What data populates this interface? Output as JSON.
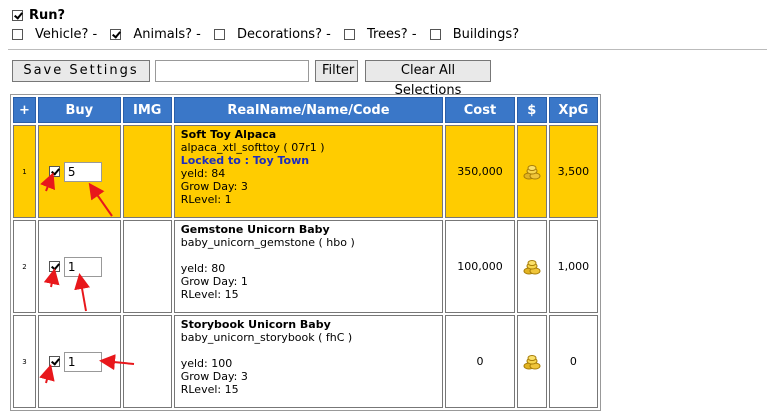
{
  "run": {
    "label": "Run?",
    "checked": true
  },
  "filters": [
    {
      "label": "Vehicle? -",
      "checked": false
    },
    {
      "label": "Animals? -",
      "checked": true
    },
    {
      "label": "Decorations? -",
      "checked": false
    },
    {
      "label": "Trees? -",
      "checked": false
    },
    {
      "label": "Buildings?",
      "checked": false
    }
  ],
  "toolbar": {
    "save_label": "Save Settings",
    "filter_value": "",
    "filter_label": "Filter",
    "clear_label": "Clear All Selections"
  },
  "table": {
    "headers": {
      "plus": "+",
      "buy": "Buy",
      "img": "IMG",
      "name": "RealName/Name/Code",
      "cost": "Cost",
      "currency": "$",
      "xpg": "XpG"
    },
    "rows": [
      {
        "index": "1",
        "checked": true,
        "qty": "5",
        "real_name": "Soft Toy Alpaca",
        "code": "alpaca_xtl_softtoy ( 07r1 )",
        "locked": "Locked to : Toy Town",
        "yield": "yeld: 84",
        "grow": "Grow Day: 3",
        "rlevel": "RLevel: 1",
        "cost": "350,000",
        "xpg": "3,500",
        "highlighted": true
      },
      {
        "index": "2",
        "checked": true,
        "qty": "1",
        "real_name": "Gemstone Unicorn Baby",
        "code": "baby_unicorn_gemstone ( hbo )",
        "locked": "",
        "yield": "yeld: 80",
        "grow": "Grow Day: 1",
        "rlevel": "RLevel: 15",
        "cost": "100,000",
        "xpg": "1,000",
        "highlighted": false
      },
      {
        "index": "3",
        "checked": true,
        "qty": "1",
        "real_name": "Storybook Unicorn Baby",
        "code": "baby_unicorn_storybook ( fhC )",
        "locked": "",
        "yield": "yeld: 100",
        "grow": "Grow Day: 3",
        "rlevel": "RLevel: 15",
        "cost": "0",
        "xpg": "0",
        "highlighted": false
      }
    ]
  },
  "colors": {
    "header_bg": "#3a77c8",
    "highlight": "#ffcc00",
    "locked_text": "#1c2dbf",
    "annotation_arrow": "#e8171b"
  },
  "icons": {
    "currency": "coins-icon"
  }
}
